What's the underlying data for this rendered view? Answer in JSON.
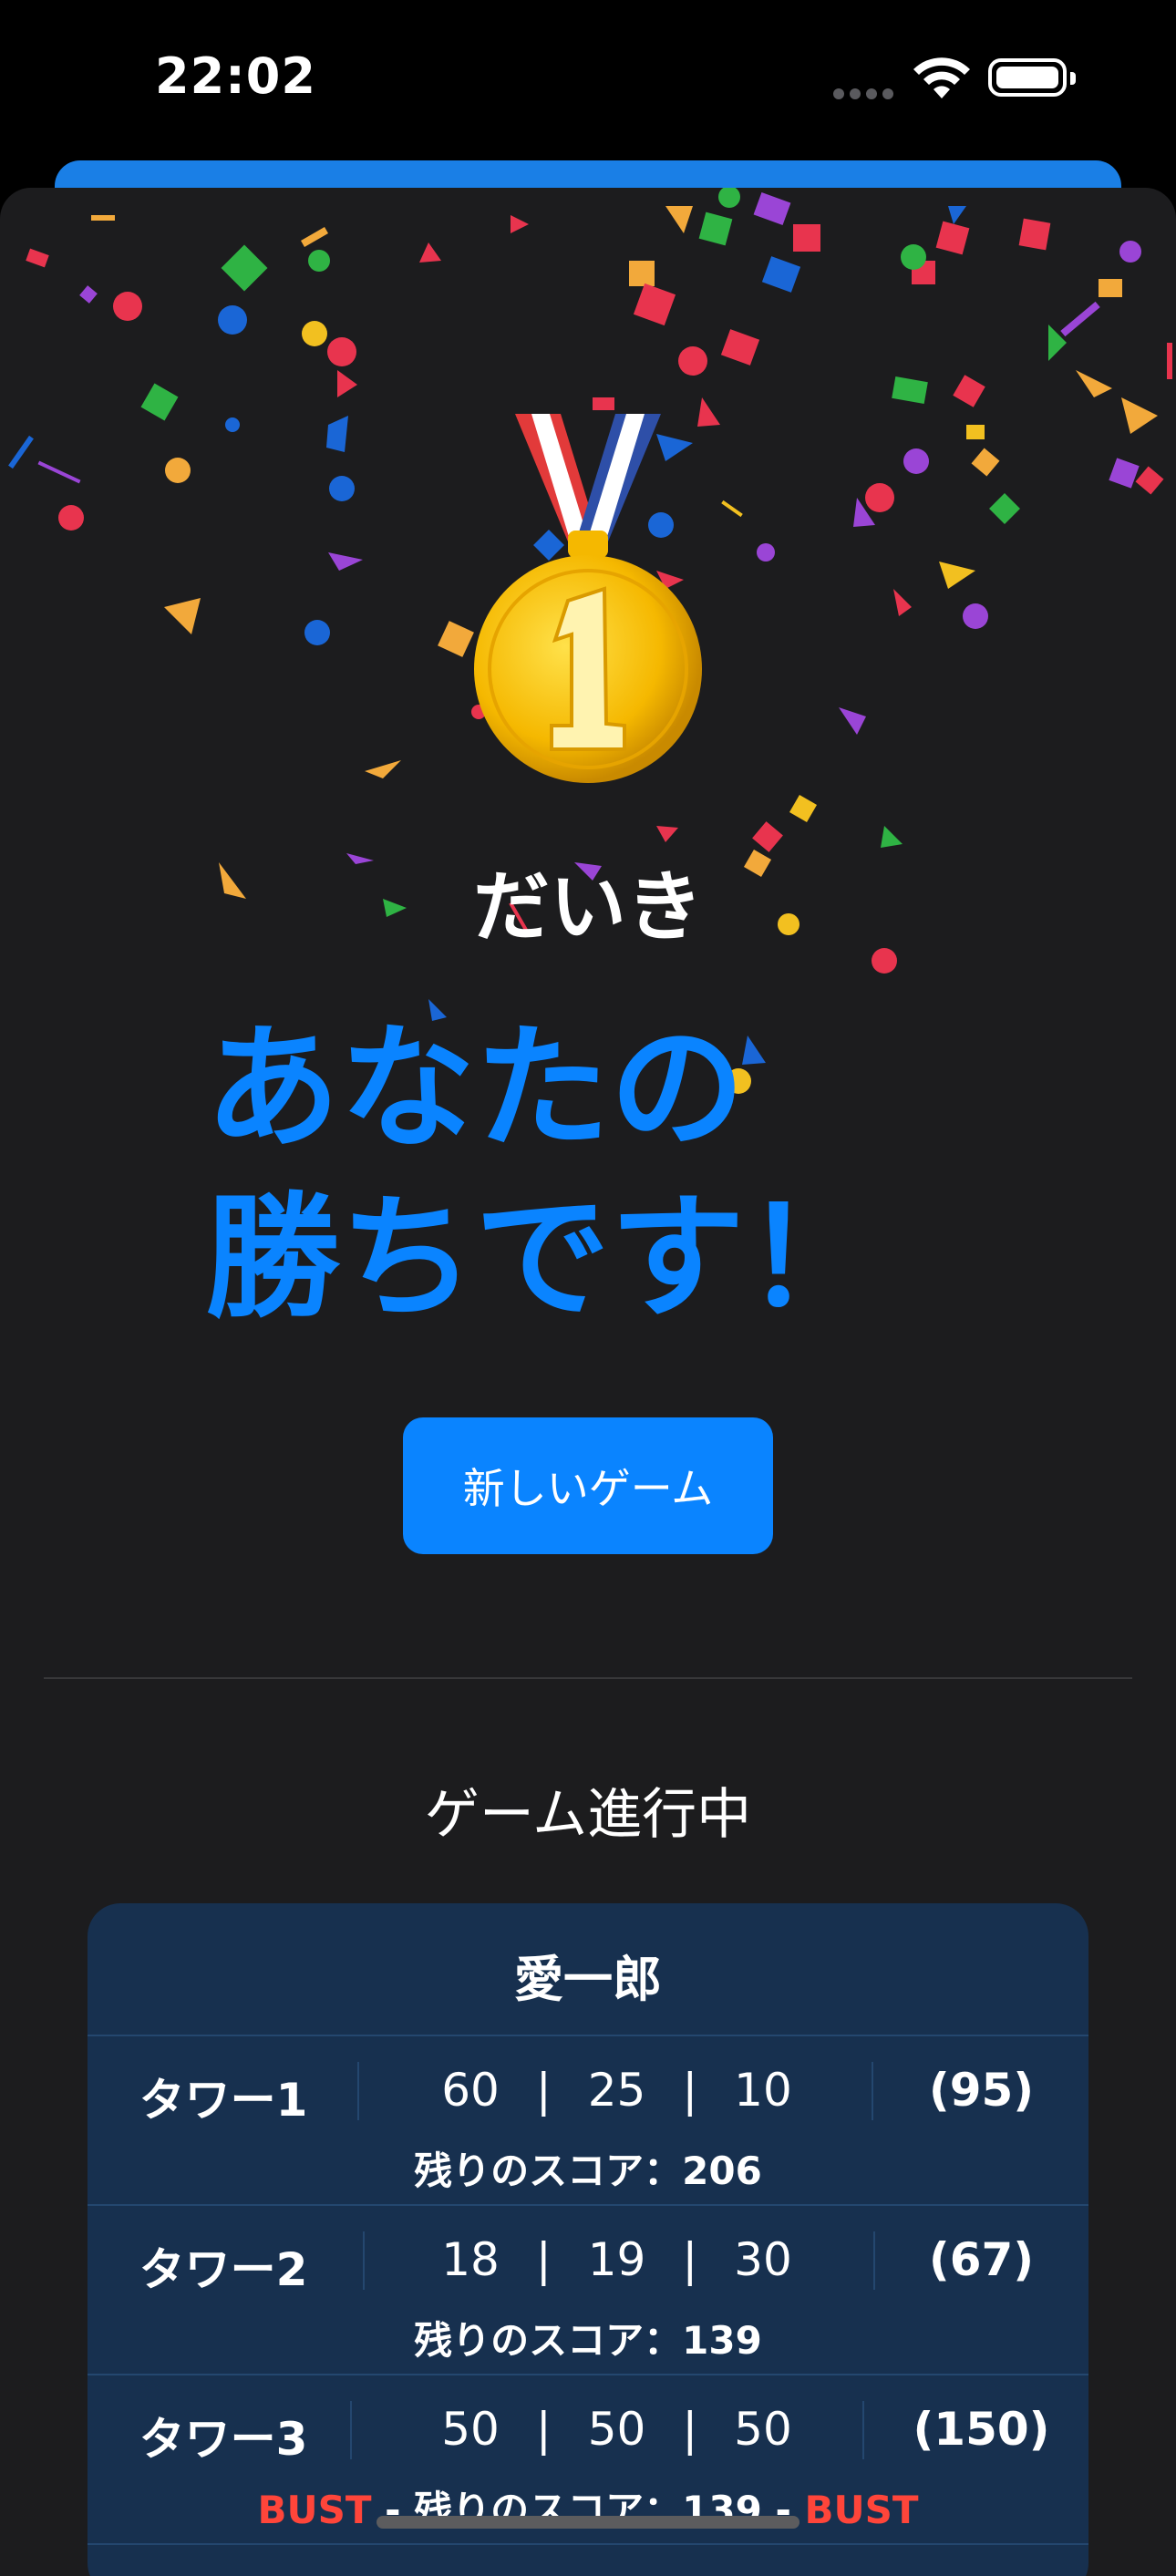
{
  "status_bar": {
    "time": "22:02"
  },
  "winner": {
    "name": "だいき",
    "message_line1": "あなたの",
    "message_line2": "勝ちです！"
  },
  "new_game_button": "新しいゲーム",
  "section_title": "ゲーム進行中",
  "scoreboard": {
    "player": "愛一郎",
    "remaining_label": "残りのスコア：",
    "bust_label": "BUST",
    "towers": [
      {
        "label": "タワー1",
        "scores": [
          "60",
          "25",
          "10"
        ],
        "total": "(95)",
        "remaining": "206",
        "bust": false
      },
      {
        "label": "タワー2",
        "scores": [
          "18",
          "19",
          "30"
        ],
        "total": "(67)",
        "remaining": "139",
        "bust": false
      },
      {
        "label": "タワー3",
        "scores": [
          "50",
          "50",
          "50"
        ],
        "total": "(150)",
        "remaining": "139",
        "bust": true
      }
    ]
  },
  "colors": {
    "accent": "#0a84ff",
    "background": "#1c1c1e",
    "card": "#17304f",
    "bust": "#ff453a"
  },
  "icons": {
    "medal": "first-place-medal-icon",
    "wifi": "wifi-icon",
    "battery": "battery-icon"
  }
}
